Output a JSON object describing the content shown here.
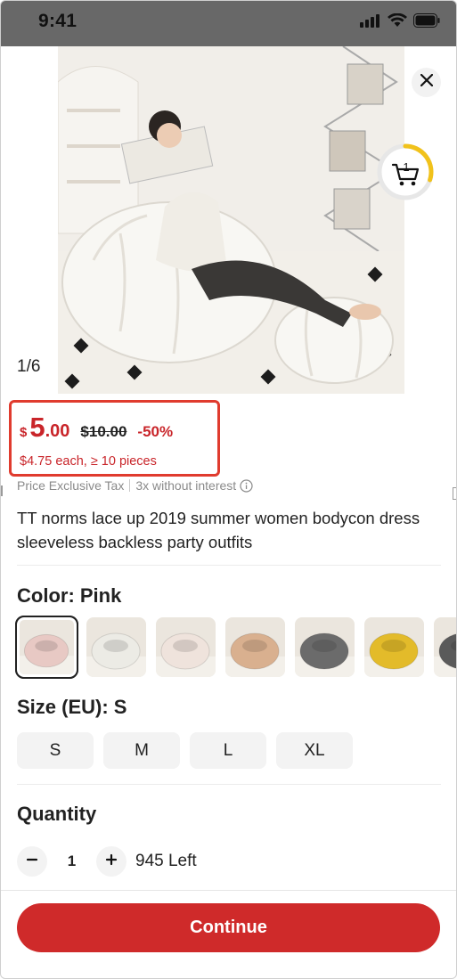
{
  "status_bar": {
    "time": "9:41",
    "icons": [
      "signal-icon",
      "wifi-icon",
      "battery-icon"
    ]
  },
  "gallery": {
    "counter": "1/6",
    "cart_count": "1",
    "cart_progress": 0.3
  },
  "price": {
    "currency": "$",
    "integer": "5",
    "decimal": ".00",
    "original": "$10.00",
    "discount": "-50%",
    "bulk": "$4.75 each, ≥ 10 pieces",
    "highlight_color": "#e03b2e",
    "price_color": "#c9252a"
  },
  "tax": {
    "exclusive": "Price Exclusive Tax",
    "installment": "3x without interest"
  },
  "product": {
    "title": "TT norms lace up 2019 summer women bodycon dress sleeveless backless party outfits"
  },
  "color": {
    "label": "Color: Pink",
    "swatches": [
      {
        "name": "Pink",
        "color": "#e8c9c4",
        "selected": true
      },
      {
        "name": "White",
        "color": "#ecebe5",
        "selected": false
      },
      {
        "name": "Cream",
        "color": "#efe3dc",
        "selected": false
      },
      {
        "name": "Beige",
        "color": "#d9b08f",
        "selected": false
      },
      {
        "name": "Grey",
        "color": "#6b6b6b",
        "selected": false
      },
      {
        "name": "Yellow",
        "color": "#e3bb2a",
        "selected": false
      },
      {
        "name": "Dark Grey",
        "color": "#5a5a5a",
        "selected": false
      }
    ]
  },
  "size": {
    "label": "Size (EU): S",
    "options": [
      "S",
      "M",
      "L",
      "XL"
    ]
  },
  "quantity": {
    "label": "Quantity",
    "value": "1",
    "left": "945 Left"
  },
  "actions": {
    "continue": "Continue",
    "button_color": "#cf2a2a"
  }
}
